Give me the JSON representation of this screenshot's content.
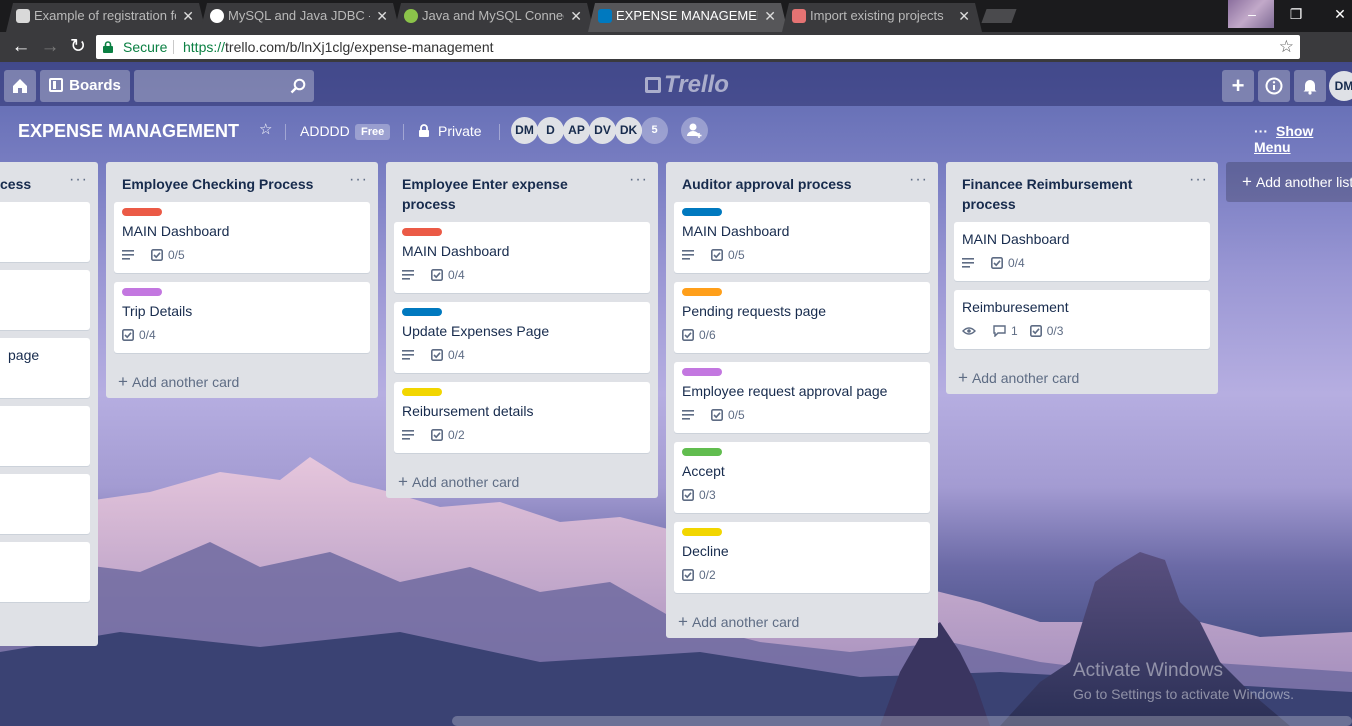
{
  "browser": {
    "tabs": [
      {
        "title": "Example of registration fo",
        "favicon_color": "#d9d9d9"
      },
      {
        "title": "MySQL and Java JDBC - T",
        "favicon_color": "#ffffff"
      },
      {
        "title": "Java and MySQL Connec",
        "favicon_color": "#8bc34a"
      },
      {
        "title": "EXPENSE MANAGEMENT",
        "favicon_color": "#0079bf"
      },
      {
        "title": "Import existing projects",
        "favicon_color": "#e57373"
      }
    ],
    "secure_label": "Secure",
    "url_scheme": "https://",
    "url_host": "trello.com",
    "url_path": "/b/lnXj1clg/expense-management"
  },
  "header": {
    "boards_label": "Boards",
    "logo_text": "Trello",
    "user_initials": "DM"
  },
  "board": {
    "title": "EXPENSE MANAGEMENT",
    "team": "ADDDD",
    "plan": "Free",
    "visibility": "Private",
    "members": [
      "DM",
      "D",
      "AP",
      "DV",
      "DK"
    ],
    "member_count": "5",
    "show_menu": "Show Menu"
  },
  "lists": [
    {
      "title": "Employee Registration Process",
      "visible_title": "cess",
      "cards": [
        {
          "title": ""
        },
        {
          "title": ""
        },
        {
          "title": "page"
        },
        {
          "title": ""
        },
        {
          "title": ""
        },
        {
          "title": ""
        }
      ]
    },
    {
      "title": "Employee Checking Process",
      "add_card": "Add another card",
      "cards": [
        {
          "label_color": "#eb5a46",
          "title": "MAIN Dashboard",
          "checklist": "0/5",
          "description": true
        },
        {
          "label_color": "#c377e0",
          "title": "Trip Details",
          "checklist": "0/4",
          "description": false
        }
      ]
    },
    {
      "title": "Employee Enter expense process",
      "add_card": "Add another card",
      "cards": [
        {
          "label_color": "#eb5a46",
          "title": "MAIN Dashboard",
          "checklist": "0/4",
          "description": true
        },
        {
          "label_color": "#0079bf",
          "title": "Update Expenses Page",
          "checklist": "0/4",
          "description": true
        },
        {
          "label_color": "#f2d600",
          "title": "Reibursement details",
          "checklist": "0/2",
          "description": true
        }
      ]
    },
    {
      "title": "Auditor approval process",
      "add_card": "Add another card",
      "cards": [
        {
          "label_color": "#0079bf",
          "title": "MAIN Dashboard",
          "checklist": "0/5",
          "description": true
        },
        {
          "label_color": "#ff9f1a",
          "title": "Pending requests page",
          "checklist": "0/6",
          "description": false
        },
        {
          "label_color": "#c377e0",
          "title": "Employee request approval page",
          "checklist": "0/5",
          "description": true
        },
        {
          "label_color": "#61bd4f",
          "title": "Accept",
          "checklist": "0/3",
          "description": false
        },
        {
          "label_color": "#f2d600",
          "title": "Decline",
          "checklist": "0/2",
          "description": false
        }
      ]
    },
    {
      "title": "Financee Reimbursement process",
      "add_card": "Add another card",
      "cards": [
        {
          "title": "MAIN Dashboard",
          "checklist": "0/4",
          "description": true
        },
        {
          "title": "Reimburesement",
          "comments": "1",
          "checklist": "0/3",
          "watching": true
        }
      ]
    }
  ],
  "add_list": "Add another list",
  "watermark": {
    "line1": "Activate Windows",
    "line2": "Go to Settings to activate Windows."
  }
}
